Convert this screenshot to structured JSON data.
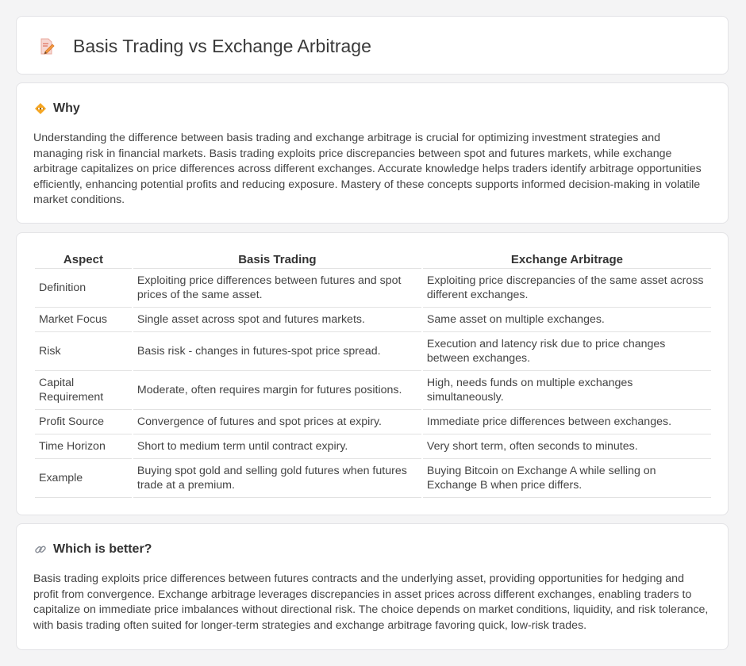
{
  "header": {
    "title": "Basis Trading vs Exchange Arbitrage",
    "icon": "pencil-note-icon"
  },
  "why": {
    "heading": "Why",
    "icon": "diamond-warning-icon",
    "text": "Understanding the difference between basis trading and exchange arbitrage is crucial for optimizing investment strategies and managing risk in financial markets. Basis trading exploits price discrepancies between spot and futures markets, while exchange arbitrage capitalizes on price differences across different exchanges. Accurate knowledge helps traders identify arbitrage opportunities efficiently, enhancing potential profits and reducing exposure. Mastery of these concepts supports informed decision-making in volatile market conditions."
  },
  "table": {
    "headers": [
      "Aspect",
      "Basis Trading",
      "Exchange Arbitrage"
    ],
    "rows": [
      [
        "Definition",
        "Exploiting price differences between futures and spot prices of the same asset.",
        "Exploiting price discrepancies of the same asset across different exchanges."
      ],
      [
        "Market Focus",
        "Single asset across spot and futures markets.",
        "Same asset on multiple exchanges."
      ],
      [
        "Risk",
        "Basis risk - changes in futures-spot price spread.",
        "Execution and latency risk due to price changes between exchanges."
      ],
      [
        "Capital Requirement",
        "Moderate, often requires margin for futures positions.",
        "High, needs funds on multiple exchanges simultaneously."
      ],
      [
        "Profit Source",
        "Convergence of futures and spot prices at expiry.",
        "Immediate price differences between exchanges."
      ],
      [
        "Time Horizon",
        "Short to medium term until contract expiry.",
        "Very short term, often seconds to minutes."
      ],
      [
        "Example",
        "Buying spot gold and selling gold futures when futures trade at a premium.",
        "Buying Bitcoin on Exchange A while selling on Exchange B when price differs."
      ]
    ]
  },
  "better": {
    "heading": "Which is better?",
    "icon": "link-icon",
    "text": "Basis trading exploits price differences between futures contracts and the underlying asset, providing opportunities for hedging and profit from convergence. Exchange arbitrage leverages discrepancies in asset prices across different exchanges, enabling traders to capitalize on immediate price imbalances without directional risk. The choice depends on market conditions, liquidity, and risk tolerance, with basis trading often suited for longer-term strategies and exchange arbitrage favoring quick, low-risk trades."
  }
}
